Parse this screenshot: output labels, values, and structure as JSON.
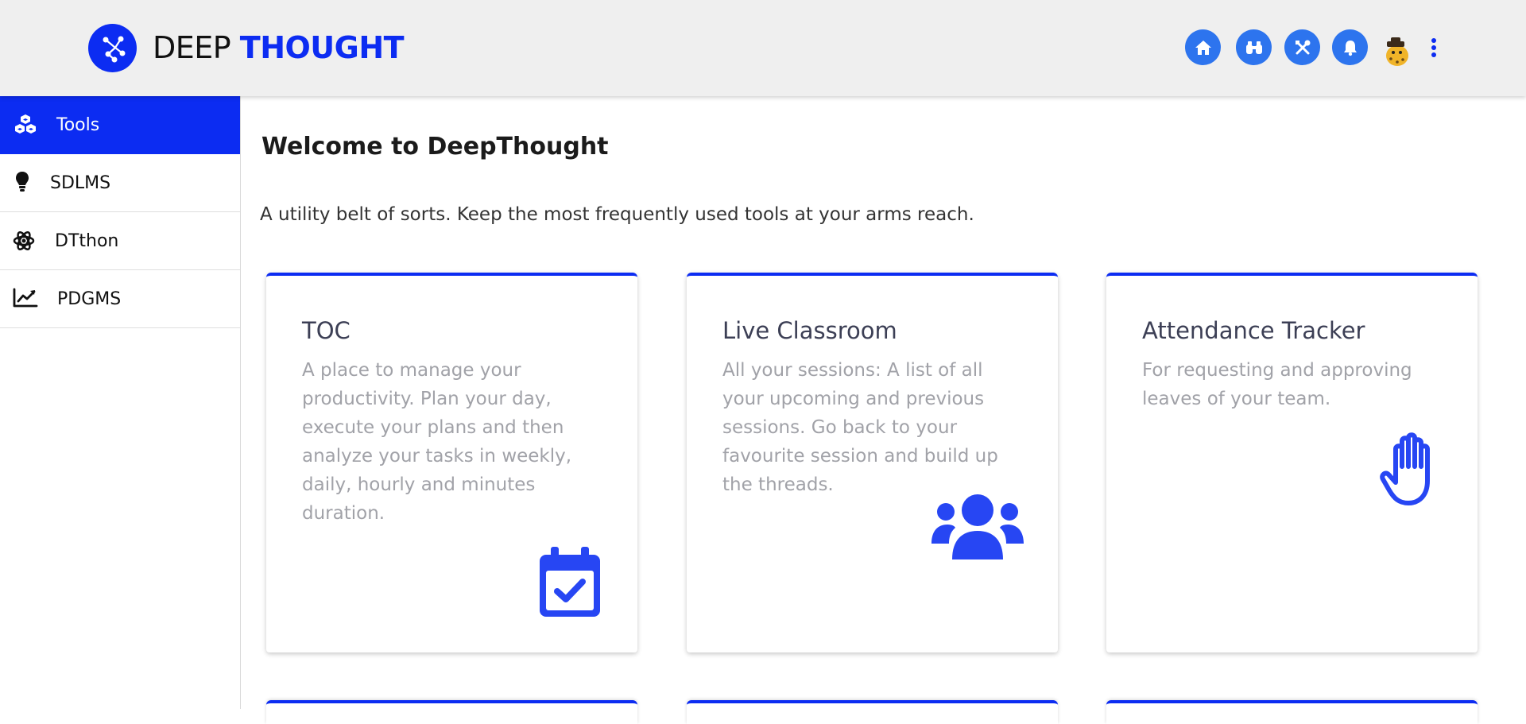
{
  "header": {
    "brand_part1": "DEEP ",
    "brand_part2": "THOUGHT",
    "icons": [
      "home-icon",
      "binoculars-icon",
      "tools-icon",
      "bell-icon",
      "avatar",
      "more-vertical-icon"
    ],
    "accent_color": "#0c2cf2",
    "icon_color": "#2d74ee"
  },
  "sidebar": {
    "items": [
      {
        "label": "Tools",
        "icon": "cubes-icon",
        "active": true
      },
      {
        "label": "SDLMS",
        "icon": "lightbulb-icon",
        "active": false
      },
      {
        "label": "DTthon",
        "icon": "atom-icon",
        "active": false
      },
      {
        "label": "PDGMS",
        "icon": "chart-line-icon",
        "active": false
      }
    ]
  },
  "main": {
    "title": "Welcome to DeepThought",
    "subtitle": "A utility belt of sorts. Keep the most frequently used tools at your arms reach.",
    "cards": [
      {
        "title": "TOC",
        "description": "A place to manage your productivity. Plan your day, execute your plans and then analyze your tasks in weekly, daily, hourly and minutes duration.",
        "icon": "calendar-check-icon"
      },
      {
        "title": "Live Classroom",
        "description": "All your sessions: A list of all your upcoming and previous sessions. Go back to your favourite session and build up the threads.",
        "icon": "users-icon"
      },
      {
        "title": "Attendance Tracker",
        "description": "For requesting and approving leaves of your team.",
        "icon": "hand-paper-icon"
      }
    ]
  }
}
